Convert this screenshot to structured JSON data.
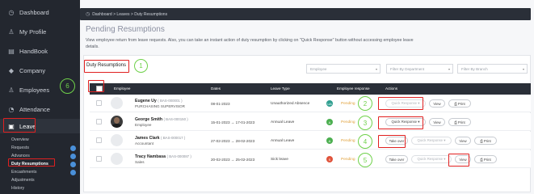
{
  "sidebar": {
    "items": [
      {
        "icon": "◷",
        "label": "Dashboard"
      },
      {
        "icon": "♙",
        "label": "My Profile"
      },
      {
        "icon": "▤",
        "label": "HandBook"
      },
      {
        "icon": "◆",
        "label": "Company"
      },
      {
        "icon": "♙",
        "label": "Employees"
      },
      {
        "icon": "◔",
        "label": "Attendance"
      },
      {
        "icon": "▣",
        "label": "Leave"
      }
    ],
    "leave_sub": [
      {
        "label": "Overview"
      },
      {
        "label": "Requests"
      },
      {
        "label": "Advances"
      },
      {
        "label": "Duty Resumptions"
      },
      {
        "label": "Encashments"
      },
      {
        "label": "Adjustments"
      },
      {
        "label": "History"
      }
    ]
  },
  "topbar": {
    "icon": "◷",
    "breadcrumb": "Dashboard > Leaves > Duty Resumptions"
  },
  "page": {
    "title": "Pending Resumptions",
    "description": "View employee return from leave requests. Also, you can take an instant action of duty resumption by clicking on \"Quick Response\" button without accessing employee leave details."
  },
  "filters": {
    "tab_label": "Duty Resumptions",
    "employee_placeholder": "Employee",
    "department_placeholder": "Filter By Department",
    "branch_placeholder": "Filter By Branch"
  },
  "table": {
    "headers": [
      "Employee",
      "Dates",
      "Leave Type",
      "Employee response",
      "Actions"
    ],
    "rows": [
      {
        "name": "Eugene Uy",
        "code": "( BAS-000001 )",
        "role": "PURCHASING SUPERVISOR",
        "dates": "08-01-2023",
        "leave_type": "Unauthorized Absence",
        "leave_badge": "UA",
        "leave_badge_color": "#2e9e8f",
        "response": "Pending",
        "actions": [
          "Quick Response ▾",
          "View",
          "⎙ Print"
        ]
      },
      {
        "name": "George Smith",
        "code": "( BAS-000150 )",
        "role": "Employee",
        "dates": "15-01-2023 → 17-01-2023",
        "leave_type": "Annual Leave",
        "leave_badge": "A",
        "leave_badge_color": "#4caf50",
        "response": "Pending",
        "actions": [
          "Quick Response ▾",
          "View",
          "⎙ Print"
        ]
      },
      {
        "name": "James Clark",
        "code": "( BAS-000017 )",
        "role": "Accountant",
        "dates": "27-02-2023 → 28-02-2023",
        "leave_type": "Annual Leave",
        "leave_badge": "A",
        "leave_badge_color": "#4caf50",
        "response": "Pending",
        "actions": [
          "Take over",
          "Quick Response ▾",
          "View",
          "⎙ Print"
        ]
      },
      {
        "name": "Tracy Nambasa",
        "code": "( BAS-000087 )",
        "role": "Sales",
        "dates": "20-02-2023 → 25-02-2023",
        "leave_type": "Sick leave",
        "leave_badge": "S",
        "leave_badge_color": "#e0533b",
        "response": "Pending",
        "actions": [
          "Take over",
          "Quick Response ▾",
          "View",
          "⎙ Print"
        ]
      }
    ]
  },
  "annotations": [
    "1",
    "2",
    "3",
    "4",
    "5",
    "6"
  ]
}
